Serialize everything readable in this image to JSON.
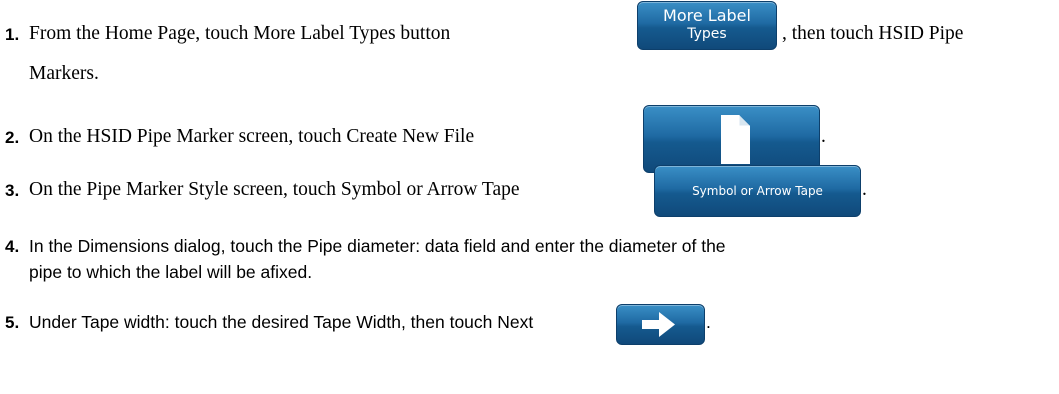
{
  "steps": [
    {
      "num": "1.",
      "before": "From the Home Page, touch More Label Types button",
      "button_lines": [
        "More Label",
        "Types"
      ],
      "after": ", then touch HSID Pipe",
      "line2": "Markers."
    },
    {
      "num": "2.",
      "before": "On the HSID Pipe Marker screen, touch Create New File",
      "button_icon": "new-file-icon",
      "after": "."
    },
    {
      "num": "3.",
      "before": "On the Pipe Marker Style screen, touch Symbol or Arrow Tape",
      "button_label": "Symbol or Arrow Tape",
      "after": "."
    },
    {
      "num": "4.",
      "line1": "In the Dimensions dialog, touch the Pipe diameter: data field and enter the diameter of the",
      "line2": "pipe to which the label will be afixed."
    },
    {
      "num": "5.",
      "before": "Under Tape width: touch the desired Tape Width, then touch Next",
      "button_icon": "right-arrow-icon",
      "after": "."
    }
  ],
  "colors": {
    "button_top": "#3a8fc6",
    "button_bottom": "#10497a",
    "button_text": "#ffffff"
  }
}
